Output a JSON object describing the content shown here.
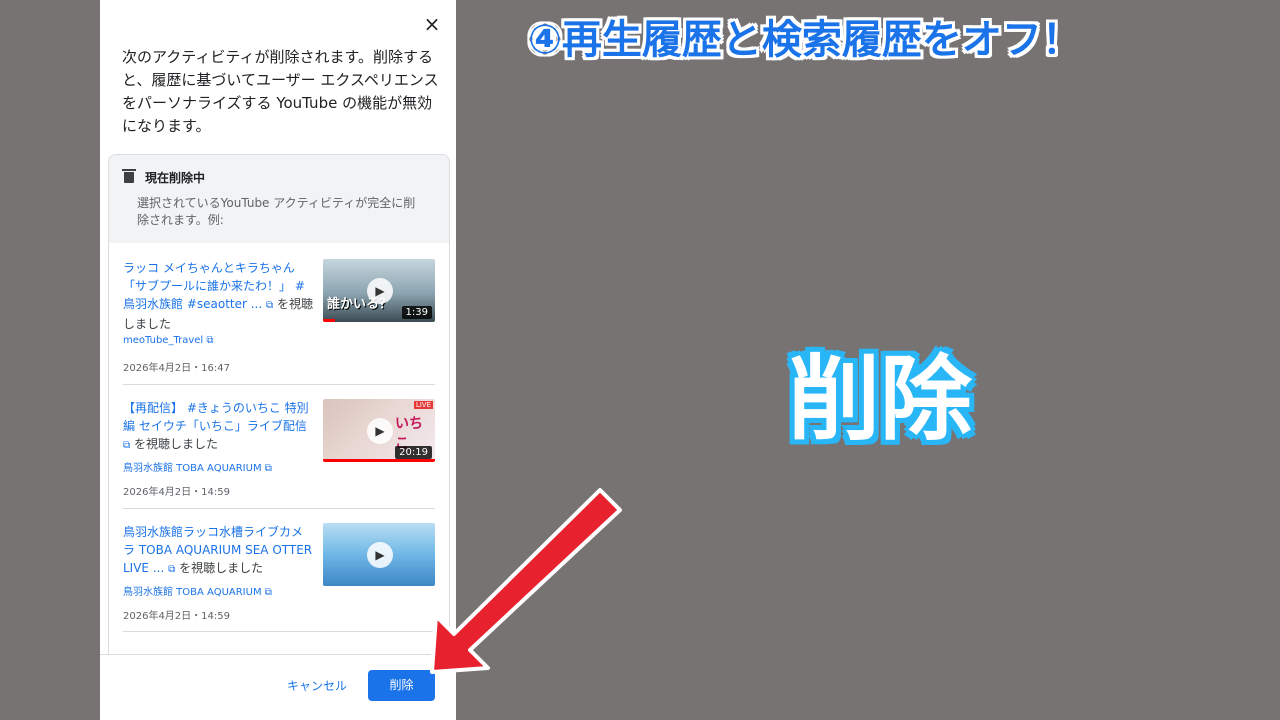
{
  "overlay": {
    "headline": "④再生履歴と検索履歴をオフ！",
    "big_label": "削除",
    "arrow_color": "#e8212e",
    "headline_color": "#1a73e8",
    "big_label_outline": "#29b6f6"
  },
  "dialog": {
    "close_icon": "×",
    "intro_text": "次のアクティビティが削除されます。削除すると、履歴に基づいてユーザー エクスペリエンスをパーソナライズする YouTube の機能が無効になります。",
    "card": {
      "title": "現在削除中",
      "description": "選択されているYouTube アクティビティが完全に削除されます。例:",
      "items": [
        {
          "title_link": "ラッコ メイちゃんとキラちゃん「サブプールに誰か来たわ！」 #鳥羽水族館 #seaotter ...",
          "suffix": "を視聴しました",
          "channel": "meoTube_Travel",
          "date": "2026年4月2日・16:47",
          "duration": "1:39",
          "thumb_text": "誰かいる？"
        },
        {
          "title_link": "【再配信】 #きょうのいちこ 特別編 セイウチ「いちこ」ライブ配信",
          "suffix": "を視聴しました",
          "channel": "鳥羽水族館 TOBA AQUARIUM",
          "date": "2026年4月2日・14:59",
          "duration": "20:19",
          "thumb_text": "いちこ",
          "badge": "LIVE"
        },
        {
          "title_link": "鳥羽水族館ラッコ水槽ライブカメラ TOBA AQUARIUM SEA OTTER LIVE ...",
          "suffix": "を視聴しました",
          "channel": "鳥羽水族館 TOBA AQUARIUM",
          "date": "2026年4月2日・14:59",
          "duration": ""
        }
      ]
    },
    "footer": {
      "cancel_label": "キャンセル",
      "delete_label": "削除"
    }
  }
}
